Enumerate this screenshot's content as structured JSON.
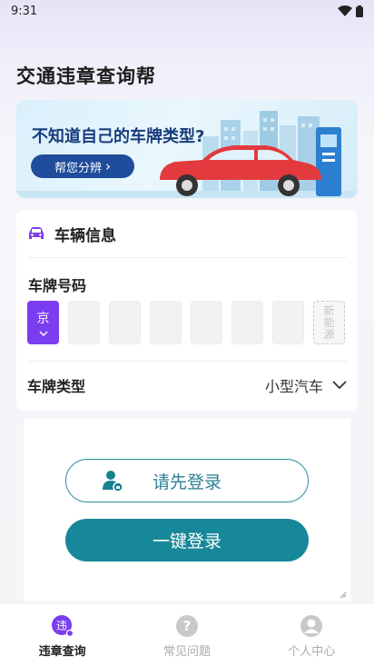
{
  "status_bar": {
    "time": "9:31"
  },
  "app": {
    "title": "交通违章查询帮"
  },
  "banner": {
    "title": "不知道自己的车牌类型?",
    "button_label": "帮您分辨",
    "button_arrow": "›"
  },
  "vehicle_card": {
    "title": "车辆信息",
    "plate_number_label": "车牌号码",
    "province": "京",
    "new_energy_label": "新\n能\n源",
    "plate_type_label": "车牌类型",
    "plate_type_value": "小型汽车"
  },
  "login": {
    "login_first_label": "请先登录",
    "one_key_login_label": "一键登录"
  },
  "tabbar": {
    "items": [
      {
        "label": "违章查询",
        "icon": "violation-icon",
        "active": true
      },
      {
        "label": "常见问题",
        "icon": "question-icon",
        "active": false
      },
      {
        "label": "个人中心",
        "icon": "user-icon",
        "active": false
      }
    ]
  },
  "colors": {
    "accent_purple": "#7a3df0",
    "teal": "#17879a",
    "banner_button": "#1f4c9b"
  }
}
